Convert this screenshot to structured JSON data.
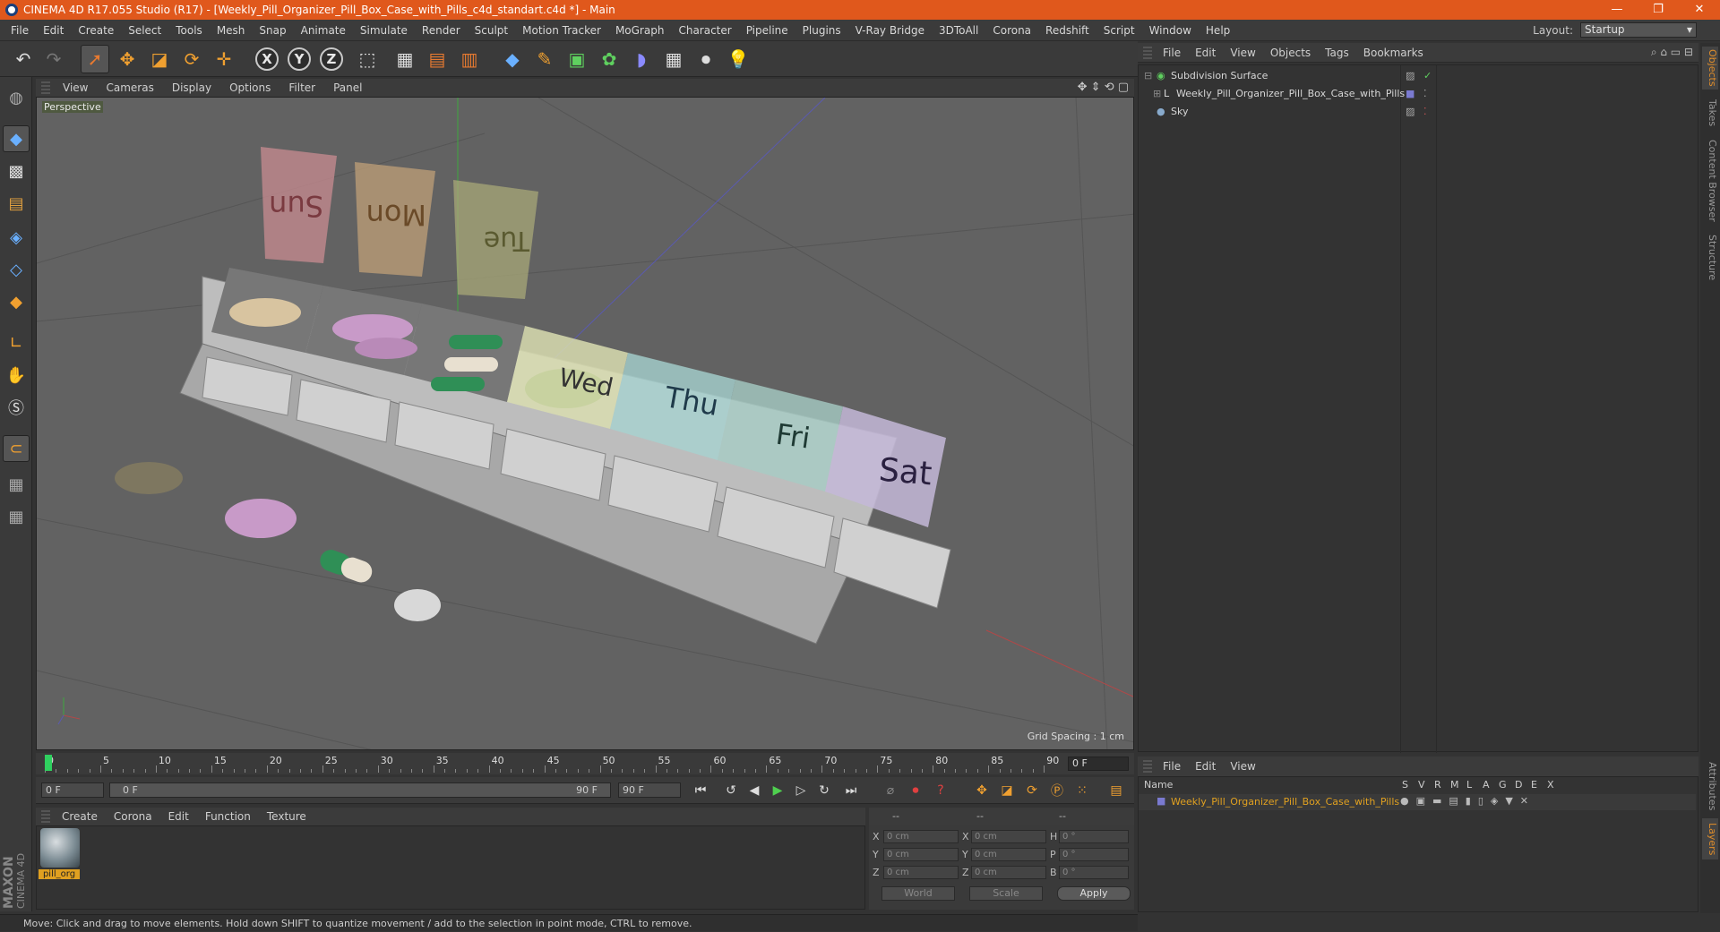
{
  "window": {
    "title": "CINEMA 4D R17.055 Studio (R17) - [Weekly_Pill_Organizer_Pill_Box_Case_with_Pills_c4d_standart.c4d *] - Main",
    "minimize": "—",
    "restore": "❐",
    "close": "✕"
  },
  "menubar": {
    "items": [
      "File",
      "Edit",
      "Create",
      "Select",
      "Tools",
      "Mesh",
      "Snap",
      "Animate",
      "Simulate",
      "Render",
      "Sculpt",
      "Motion Tracker",
      "MoGraph",
      "Character",
      "Pipeline",
      "Plugins",
      "V-Ray Bridge",
      "3DToAll",
      "Corona",
      "Redshift",
      "Script",
      "Window",
      "Help"
    ],
    "layout_label": "Layout:",
    "layout_value": "Startup"
  },
  "viewport": {
    "menu": [
      "View",
      "Cameras",
      "Display",
      "Options",
      "Filter",
      "Panel"
    ],
    "label": "Perspective",
    "grid_spacing": "Grid Spacing : 1 cm",
    "day_labels": [
      "Sun",
      "Mon",
      "Tue",
      "Wed",
      "Thu",
      "Fri",
      "Sat"
    ]
  },
  "timeline": {
    "ticks": [
      "0",
      "5",
      "10",
      "15",
      "20",
      "25",
      "30",
      "35",
      "40",
      "45",
      "50",
      "55",
      "60",
      "65",
      "70",
      "75",
      "80",
      "85",
      "90"
    ],
    "current_frame": "0 F"
  },
  "transport": {
    "start": "0 F",
    "range_start": "0 F",
    "range_end": "90 F",
    "end": "90 F"
  },
  "materials": {
    "menu": [
      "Create",
      "Corona",
      "Edit",
      "Function",
      "Texture"
    ],
    "items": [
      {
        "name": "pill_org"
      }
    ]
  },
  "coordinates": {
    "headers": [
      "--",
      "--",
      "--"
    ],
    "rows": [
      {
        "a": "X",
        "av": "0 cm",
        "b": "X",
        "bv": "0 cm",
        "c": "H",
        "cv": "0 °"
      },
      {
        "a": "Y",
        "av": "0 cm",
        "b": "Y",
        "bv": "0 cm",
        "c": "P",
        "cv": "0 °"
      },
      {
        "a": "Z",
        "av": "0 cm",
        "b": "Z",
        "bv": "0 cm",
        "c": "B",
        "cv": "0 °"
      }
    ],
    "mode1": "World",
    "mode2": "Scale",
    "apply": "Apply"
  },
  "status": "Move: Click and drag to move elements. Hold down SHIFT to quantize movement / add to the selection in point mode, CTRL to remove.",
  "object_manager": {
    "menu": [
      "File",
      "Edit",
      "View",
      "Objects",
      "Tags",
      "Bookmarks"
    ],
    "objects": [
      {
        "name": "Subdivision Surface",
        "icon": "subdivision-icon"
      },
      {
        "name": "Weekly_Pill_Organizer_Pill_Box_Case_with_Pills",
        "icon": "null-object-icon"
      },
      {
        "name": "Sky",
        "icon": "sky-icon"
      }
    ]
  },
  "layer_manager": {
    "menu": [
      "File",
      "Edit",
      "View"
    ],
    "name_header": "Name",
    "columns": [
      "S",
      "V",
      "R",
      "M",
      "L",
      "A",
      "G",
      "D",
      "E",
      "X"
    ],
    "layers": [
      {
        "name": "Weekly_Pill_Organizer_Pill_Box_Case_with_Pills",
        "color": "#7a7ad0"
      }
    ]
  },
  "side_tabs": [
    "Objects",
    "Takes",
    "Content Browser",
    "Structure",
    "Attributes",
    "Layers"
  ],
  "brand": {
    "line1": "MAXON",
    "line2": "CINEMA 4D"
  },
  "colors": {
    "accent": "#e0581c",
    "highlight": "#e0a020"
  }
}
